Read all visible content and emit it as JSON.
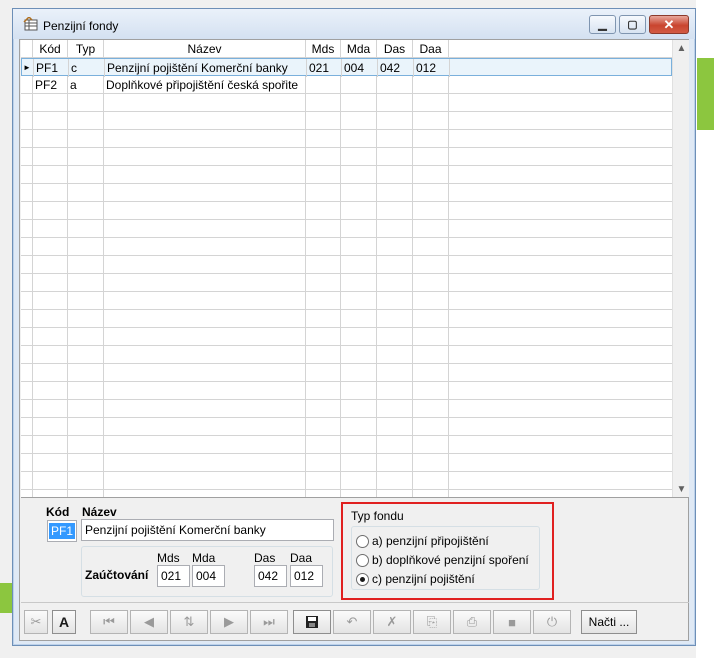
{
  "window": {
    "title": "Penzijní fondy"
  },
  "grid": {
    "columns": [
      "Kód",
      "Typ",
      "Název",
      "Mds",
      "Mda",
      "Das",
      "Daa"
    ],
    "rows": [
      {
        "kod": "PF1",
        "typ": "c",
        "nazev": "Penzijní pojištění Komerční banky",
        "mds": "021",
        "mda": "004",
        "das": "042",
        "daa": "012",
        "selected": true
      },
      {
        "kod": "PF2",
        "typ": "a",
        "nazev": "Doplňkové připojištění česká spořite",
        "mds": "",
        "mda": "",
        "das": "",
        "daa": "",
        "selected": false
      }
    ],
    "row_indicator": "►"
  },
  "detail": {
    "kod_label": "Kód",
    "nazev_label": "Název",
    "kod_value": "PF1",
    "nazev_value": "Penzijní pojištění Komerční banky",
    "zauctovani_label": "Zaúčtování",
    "mds_label": "Mds",
    "mda_label": "Mda",
    "das_label": "Das",
    "daa_label": "Daa",
    "mds_value": "021",
    "mda_value": "004",
    "das_value": "042",
    "daa_value": "012"
  },
  "typ_fondu": {
    "label": "Typ fondu",
    "options": [
      {
        "label": "a) penzijní připojištění",
        "checked": false
      },
      {
        "label": "b) doplňkové penzijní spoření",
        "checked": false
      },
      {
        "label": "c) penzijní pojištění",
        "checked": true
      }
    ]
  },
  "toolbar": {
    "icons": [
      "delete-icon",
      "font-icon",
      "first-record-icon",
      "previous-record-icon",
      "sort-icon",
      "next-record-icon",
      "last-record-icon",
      "save-icon",
      "undo-icon",
      "cancel-icon",
      "copy-icon",
      "print-icon",
      "stop-icon",
      "power-icon"
    ],
    "nacti_label": "Načti ..."
  },
  "colors": {
    "highlight": "#3399ff",
    "frame_red": "#e02020",
    "selected_row": "#eaf4fb"
  }
}
